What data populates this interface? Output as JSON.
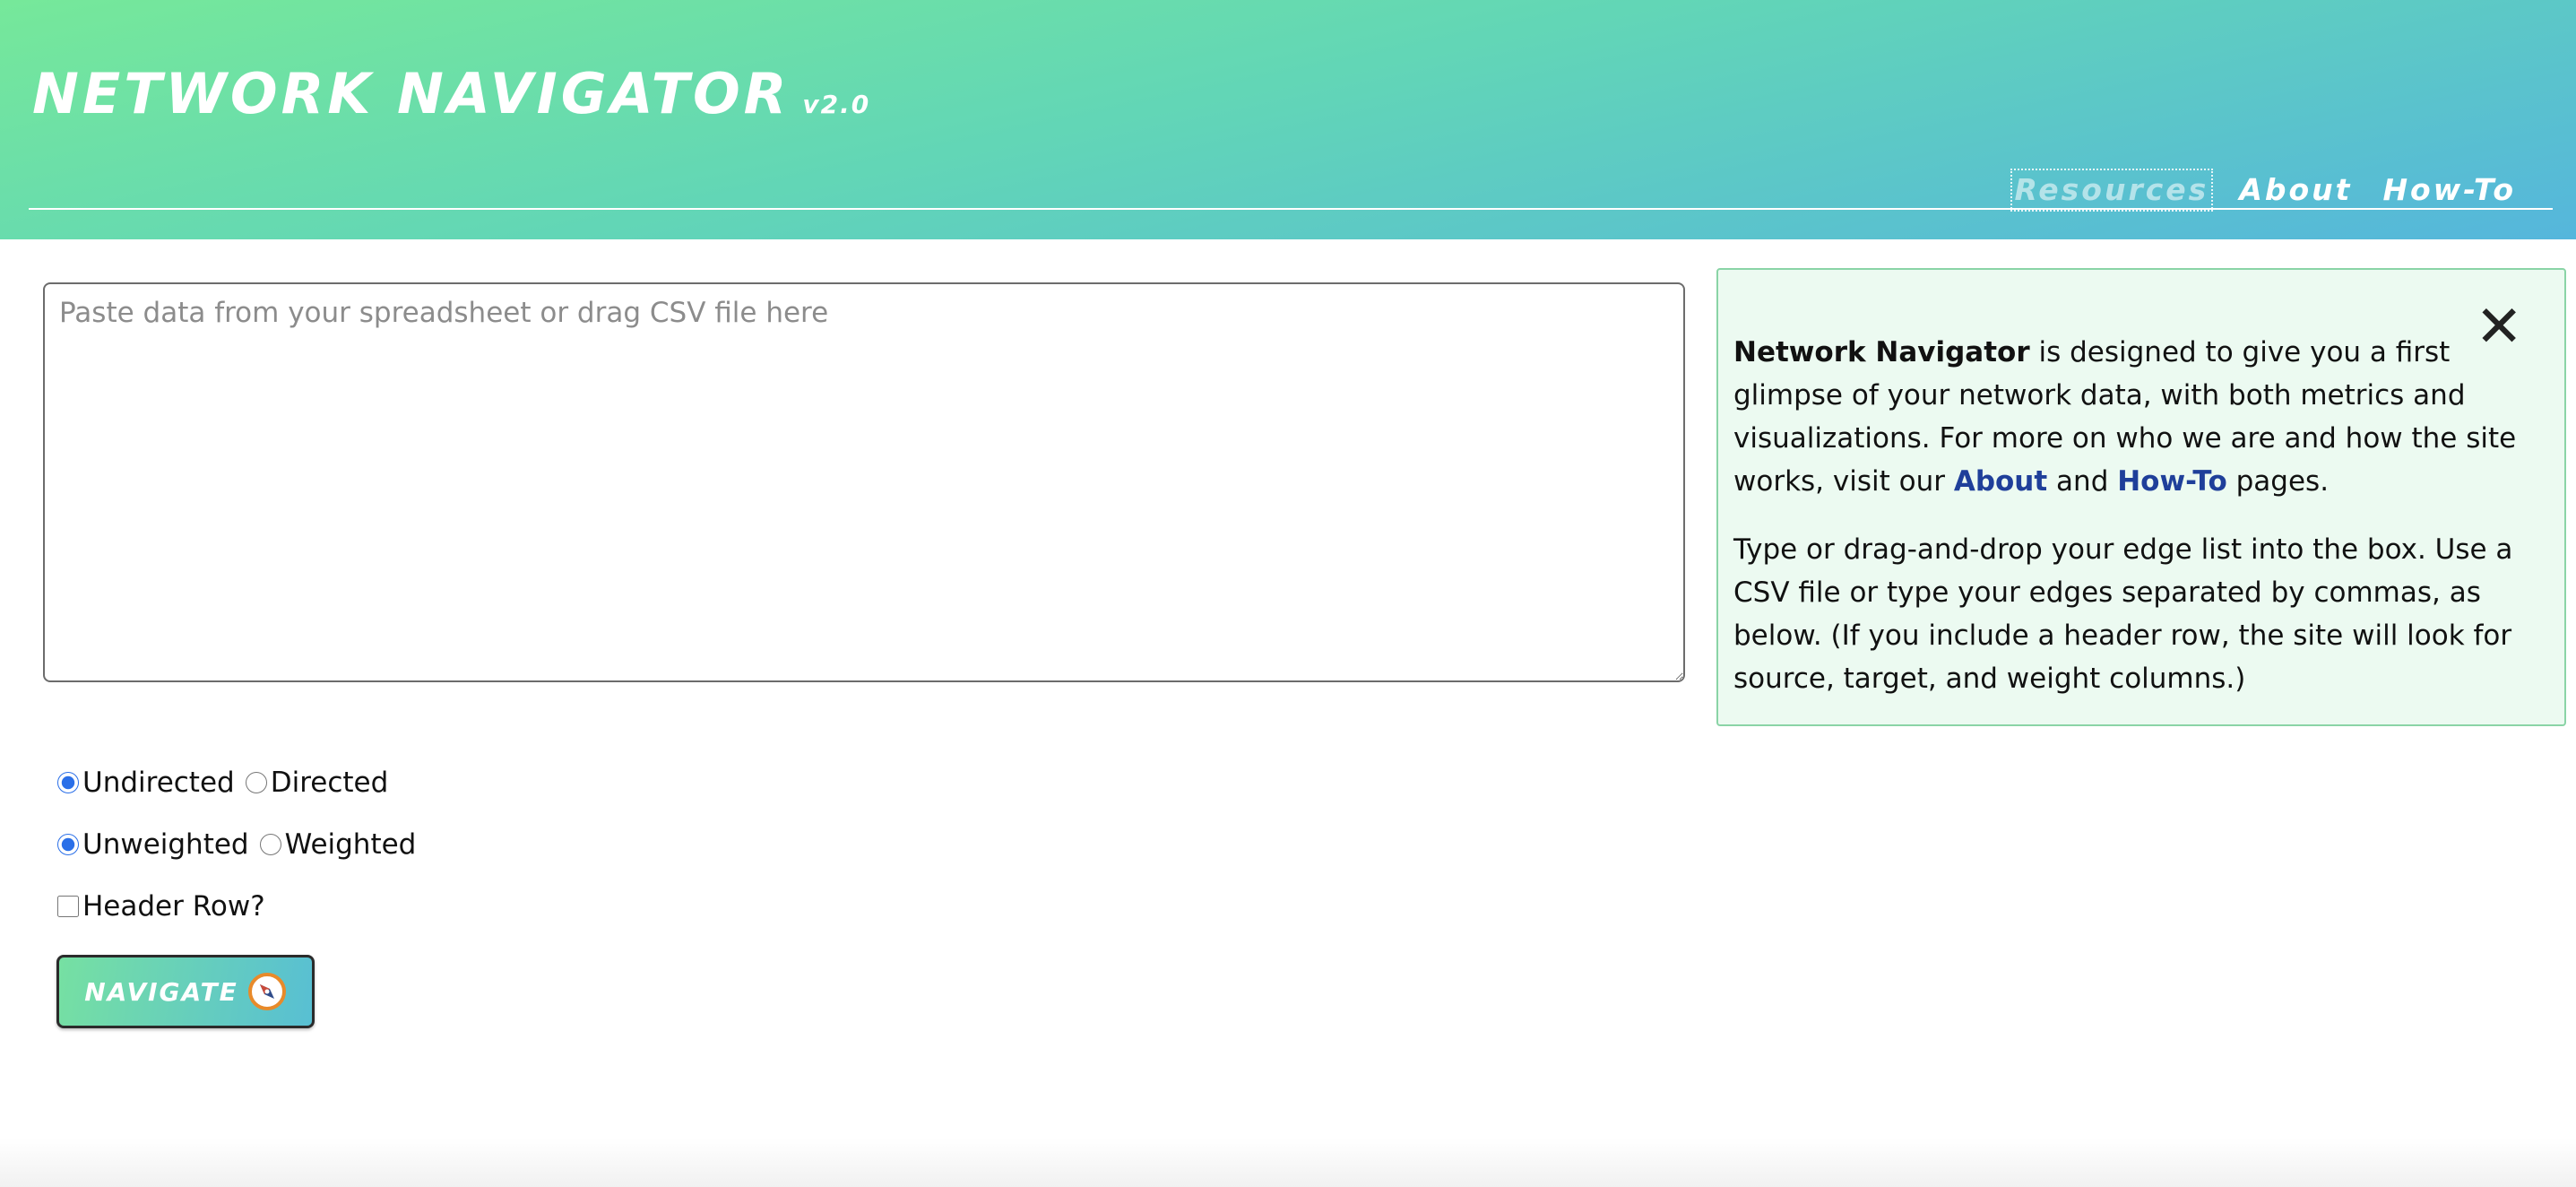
{
  "header": {
    "title": "NETWORK NAVIGATOR",
    "version": "v2.0",
    "nav": [
      {
        "label": "Resources",
        "active": true
      },
      {
        "label": "About",
        "active": false
      },
      {
        "label": "How-To",
        "active": false
      }
    ]
  },
  "input": {
    "placeholder": "Paste data from your spreadsheet or drag CSV file here",
    "value": ""
  },
  "info": {
    "close_icon": "✕",
    "p1": {
      "brand": "Network Navigator",
      "text1": " is designed to give you a first glimpse of your network data, with both metrics and visualizations. For more on who we are and how the site works, visit our ",
      "link_about": "About",
      "text2": " and ",
      "link_howto": "How-To",
      "text3": " pages."
    },
    "p2": "Type or drag-and-drop your edge list into the box. Use a CSV file or type your edges separated by commas, as below. (If you include a header row, the site will look for source, target, and weight columns.)"
  },
  "options": {
    "direction": {
      "options": [
        "Undirected",
        "Directed"
      ],
      "selected": "Undirected"
    },
    "weight": {
      "options": [
        "Unweighted",
        "Weighted"
      ],
      "selected": "Unweighted"
    },
    "header_row": {
      "label": "Header Row?",
      "checked": false
    }
  },
  "navigate_button": {
    "label": "NAVIGATE",
    "icon": "compass-icon"
  },
  "colors": {
    "header_gradient_start": "#76e89a",
    "header_gradient_end": "#55b6dc",
    "link": "#1f3f9a",
    "panel_bg": "#ecfaf1",
    "radio_accent": "#2a6fe8"
  }
}
